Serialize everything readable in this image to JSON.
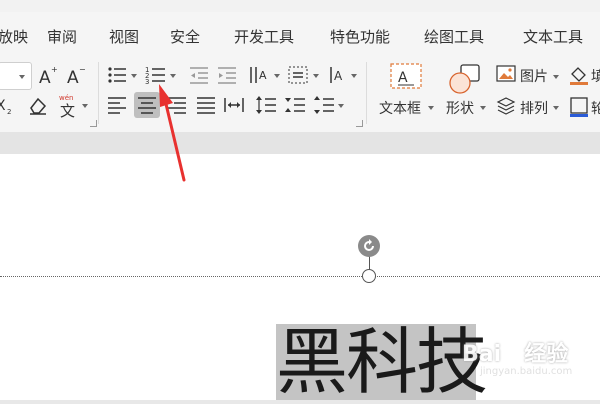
{
  "tabs": [
    {
      "label": "放映"
    },
    {
      "label": "审阅"
    },
    {
      "label": "视图"
    },
    {
      "label": "安全"
    },
    {
      "label": "开发工具"
    },
    {
      "label": "特色功能"
    },
    {
      "label": "绘图工具"
    },
    {
      "label": "文本工具"
    }
  ],
  "ribbon": {
    "pinyin_top": "wén",
    "pinyin_char": "文",
    "textbox_label": "文本框",
    "shape_label": "形状",
    "picture_label": "图片",
    "arrange_label": "排列",
    "fill_label_partial": "填",
    "frame_label_partial": "轮"
  },
  "canvas": {
    "selected_text": "黑科技"
  },
  "watermark": {
    "brand": "Bai",
    "brand_cn": "经验",
    "url": "jingyan.baidu.com"
  },
  "colors": {
    "arrow": "#e8312f",
    "accent_orange": "#e07a3a",
    "selection_bg": "#c4c4c4"
  }
}
